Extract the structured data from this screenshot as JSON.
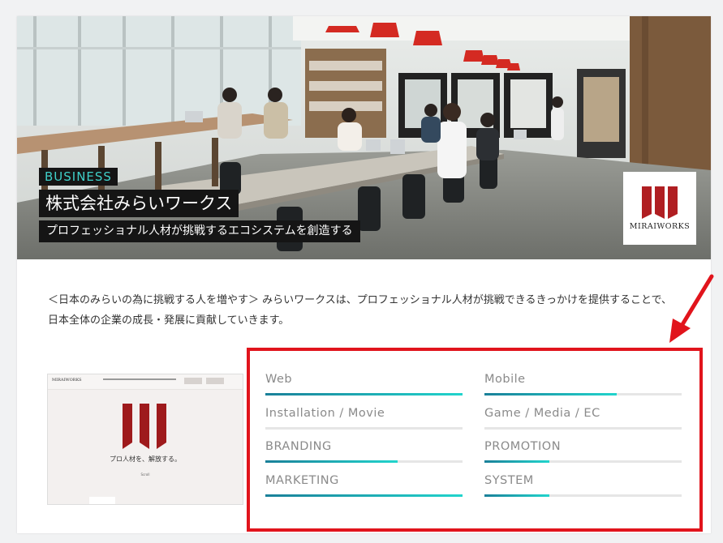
{
  "hero": {
    "badge": "BUSINESS",
    "company_name": "株式会社みらいワークス",
    "tagline": "プロフェッショナル人材が挑戦するエコシステムを創造する",
    "logo_text": "MIRAIWORKS"
  },
  "description": "＜日本のみらいの為に挑戦する人を増やす＞ みらいワークスは、プロフェッショナル人材が挑戦できるきっかけを提供することで、日本全体の企業の成長・発展に貢献していきます。",
  "thumbnail": {
    "brand": "MIRAIWORKS",
    "caption": "プロ人材を、解放する。",
    "scroll": "Scroll"
  },
  "skills": [
    {
      "label": "Web",
      "level": 1.0
    },
    {
      "label": "Mobile",
      "level": 0.67
    },
    {
      "label": "Installation / Movie",
      "level": 0.0
    },
    {
      "label": "Game / Media / EC",
      "level": 0.0
    },
    {
      "label": "BRANDING",
      "level": 0.67
    },
    {
      "label": "PROMOTION",
      "level": 0.33
    },
    {
      "label": "MARKETING",
      "level": 1.0
    },
    {
      "label": "SYSTEM",
      "level": 0.33
    }
  ],
  "colors": {
    "accent": "#21d4cc",
    "accent_dark": "#1a8099",
    "badge_text": "#3fd0c9",
    "annotation": "#e1141c",
    "logo_red": "#b01e22"
  }
}
